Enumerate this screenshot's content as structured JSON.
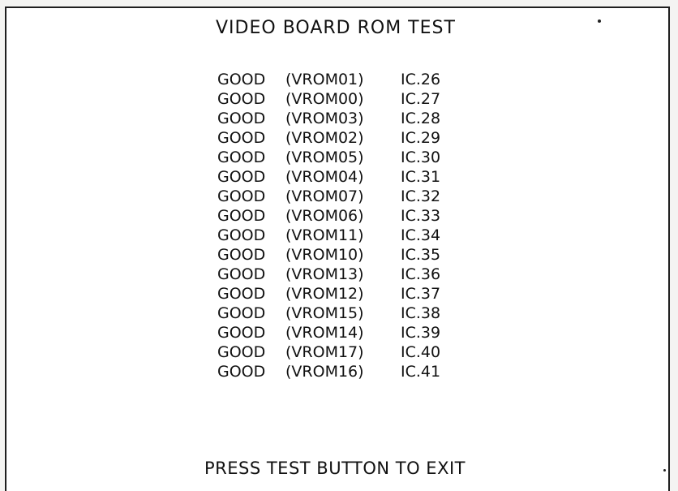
{
  "screen": {
    "title": "VIDEO BOARD ROM TEST",
    "footer": "PRESS TEST BUTTON TO EXIT"
  },
  "rows": [
    {
      "status": "GOOD",
      "rom": "(VROM01)",
      "ic": "IC.26"
    },
    {
      "status": "GOOD",
      "rom": "(VROM00)",
      "ic": "IC.27"
    },
    {
      "status": "GOOD",
      "rom": "(VROM03)",
      "ic": "IC.28"
    },
    {
      "status": "GOOD",
      "rom": "(VROM02)",
      "ic": "IC.29"
    },
    {
      "status": "GOOD",
      "rom": "(VROM05)",
      "ic": "IC.30"
    },
    {
      "status": "GOOD",
      "rom": "(VROM04)",
      "ic": "IC.31"
    },
    {
      "status": "GOOD",
      "rom": "(VROM07)",
      "ic": "IC.32"
    },
    {
      "status": "GOOD",
      "rom": "(VROM06)",
      "ic": "IC.33"
    },
    {
      "status": "GOOD",
      "rom": "(VROM11)",
      "ic": "IC.34"
    },
    {
      "status": "GOOD",
      "rom": "(VROM10)",
      "ic": "IC.35"
    },
    {
      "status": "GOOD",
      "rom": "(VROM13)",
      "ic": "IC.36"
    },
    {
      "status": "GOOD",
      "rom": "(VROM12)",
      "ic": "IC.37"
    },
    {
      "status": "GOOD",
      "rom": "(VROM15)",
      "ic": "IC.38"
    },
    {
      "status": "GOOD",
      "rom": "(VROM14)",
      "ic": "IC.39"
    },
    {
      "status": "GOOD",
      "rom": "(VROM17)",
      "ic": "IC.40"
    },
    {
      "status": "GOOD",
      "rom": "(VROM16)",
      "ic": "IC.41"
    }
  ]
}
